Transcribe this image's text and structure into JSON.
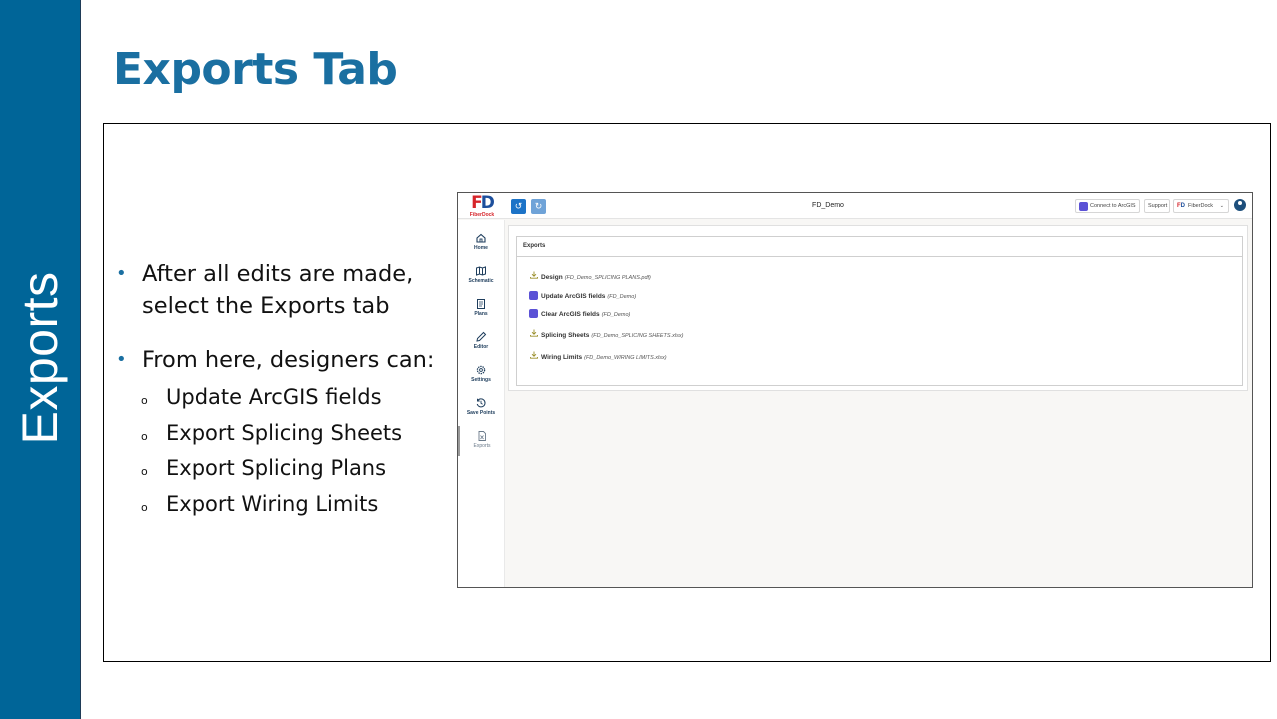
{
  "side_band": {
    "label": "Exports",
    "color": "#006598"
  },
  "slide": {
    "title": "Exports Tab"
  },
  "bullets": [
    {
      "text": "After all edits are made, select the Exports tab"
    },
    {
      "text": "From here, designers can:"
    }
  ],
  "sub_bullets": [
    "Update ArcGIS fields",
    "Export Splicing Sheets",
    "Export Splicing Plans",
    "Export Wiring Limits"
  ],
  "app": {
    "logo": {
      "mark_f": "F",
      "mark_d": "D",
      "brand": "FiberDock"
    },
    "title": "FD_Demo",
    "header": {
      "connect_label": "Connect to ArcGIS",
      "support_label": "Support",
      "account_label": "FiberDock"
    },
    "nav": [
      {
        "label": "Home",
        "icon": "home-icon"
      },
      {
        "label": "Schematic",
        "icon": "map-icon"
      },
      {
        "label": "Plans",
        "icon": "document-icon"
      },
      {
        "label": "Editor",
        "icon": "pencil-icon"
      },
      {
        "label": "Settings",
        "icon": "gear-icon"
      },
      {
        "label": "Save Points",
        "icon": "history-icon"
      },
      {
        "label": "Exports",
        "icon": "spreadsheet-icon",
        "active": true
      }
    ],
    "panel_title": "Exports",
    "exports": [
      {
        "label": "Design",
        "file": "(FD_Demo_SPLICING PLANS.pdf)",
        "icon": "download-icon"
      },
      {
        "label": "Update ArcGIS fields",
        "file": "(FD_Demo)",
        "icon": "arcgis-icon"
      },
      {
        "label": "Clear ArcGIS fields",
        "file": "(FD_Demo)",
        "icon": "arcgis-icon"
      },
      {
        "label": "Splicing Sheets",
        "file": "(FD_Demo_SPLICING SHEETS.xlsx)",
        "icon": "download-icon"
      },
      {
        "label": "Wiring Limits",
        "file": "(FD_Demo_WIRING LIMITS.xlsx)",
        "icon": "download-icon"
      }
    ]
  }
}
